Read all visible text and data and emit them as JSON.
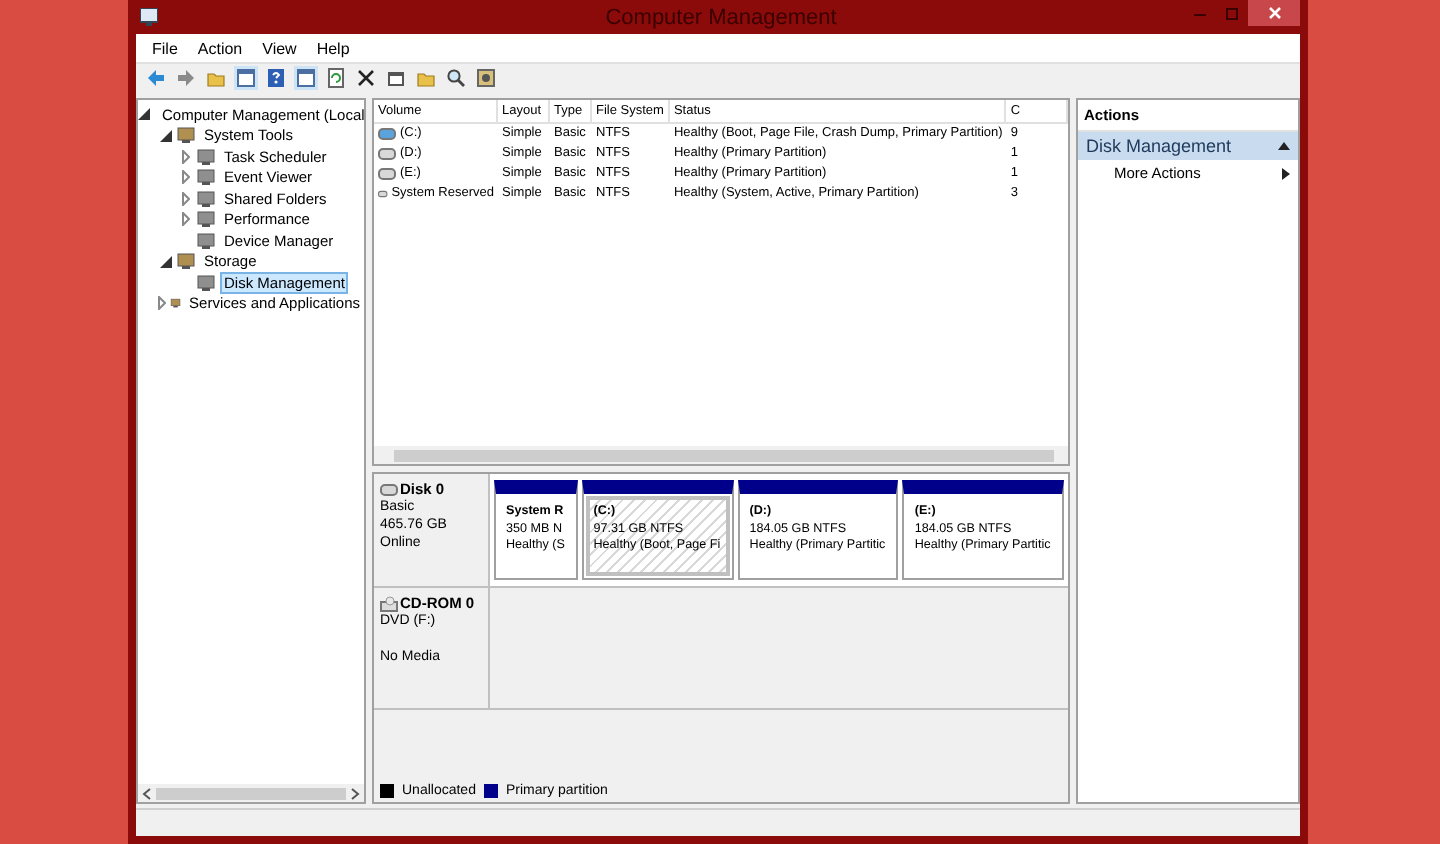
{
  "window": {
    "title": "Computer Management"
  },
  "menu": [
    "File",
    "Action",
    "View",
    "Help"
  ],
  "tree": [
    {
      "label": "Computer Management (Local",
      "kind": "node",
      "expanded": true,
      "selected": false,
      "children": [
        {
          "label": "System Tools",
          "kind": "node",
          "expanded": true,
          "selected": false,
          "children": [
            {
              "label": "Task Scheduler",
              "kind": "node",
              "expanded": false,
              "selected": false
            },
            {
              "label": "Event Viewer",
              "kind": "node",
              "expanded": false,
              "selected": false
            },
            {
              "label": "Shared Folders",
              "kind": "node",
              "expanded": false,
              "selected": false
            },
            {
              "label": "Performance",
              "kind": "node",
              "expanded": false,
              "selected": false
            },
            {
              "label": "Device Manager",
              "kind": "leaf",
              "selected": false
            }
          ]
        },
        {
          "label": "Storage",
          "kind": "node",
          "expanded": true,
          "selected": false,
          "children": [
            {
              "label": "Disk Management",
              "kind": "leaf",
              "selected": true
            }
          ]
        },
        {
          "label": "Services and Applications",
          "kind": "node",
          "expanded": false,
          "selected": false
        }
      ]
    }
  ],
  "table": {
    "columns": [
      "Volume",
      "Layout",
      "Type",
      "File System",
      "Status",
      "C"
    ],
    "rows": [
      {
        "cells": [
          "(C:)",
          "Simple",
          "Basic",
          "NTFS",
          "Healthy (Boot, Page File, Crash Dump, Primary Partition)",
          "9"
        ],
        "system": true
      },
      {
        "cells": [
          "(D:)",
          "Simple",
          "Basic",
          "NTFS",
          "Healthy (Primary Partition)",
          "1"
        ],
        "system": false
      },
      {
        "cells": [
          "(E:)",
          "Simple",
          "Basic",
          "NTFS",
          "Healthy (Primary Partition)",
          "1"
        ],
        "system": false
      },
      {
        "cells": [
          "System Reserved",
          "Simple",
          "Basic",
          "NTFS",
          "Healthy (System, Active, Primary Partition)",
          "3"
        ],
        "system": false
      }
    ]
  },
  "disks": [
    {
      "kind": "disk",
      "name": "Disk 0",
      "lines": [
        "Basic",
        "465.76 GB",
        "Online"
      ],
      "partitions": [
        {
          "name": "System R",
          "size": "350 MB N",
          "status": "Healthy (S",
          "selected": false
        },
        {
          "name": "(C:)",
          "size": "97.31 GB NTFS",
          "status": "Healthy (Boot, Page Fi",
          "selected": true
        },
        {
          "name": "(D:)",
          "size": "184.05 GB NTFS",
          "status": "Healthy (Primary Partitic",
          "selected": false
        },
        {
          "name": "(E:)",
          "size": "184.05 GB NTFS",
          "status": "Healthy (Primary Partitic",
          "selected": false
        }
      ]
    },
    {
      "kind": "cdrom",
      "name": "CD-ROM 0",
      "lines": [
        "DVD (F:)"
      ],
      "media": "No Media"
    }
  ],
  "legend": [
    {
      "label": "Unallocated",
      "color": "#000000"
    },
    {
      "label": "Primary partition",
      "color": "#00008b"
    }
  ],
  "actions": {
    "title": "Actions",
    "section": {
      "label": "Disk Management",
      "expanded": true
    },
    "items": [
      "More Actions"
    ]
  }
}
